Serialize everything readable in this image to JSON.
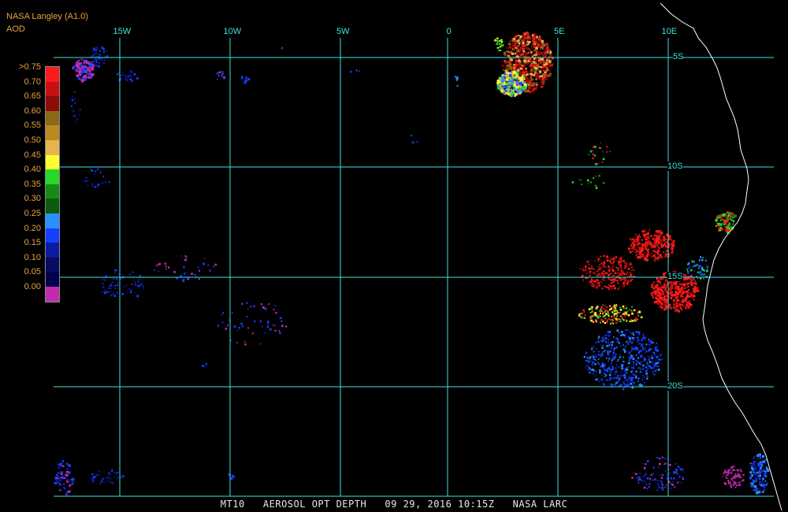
{
  "header": {
    "source": "NASA Langley (A1.0)",
    "variable": "AOD"
  },
  "legend": {
    "labels": [
      ">0.75",
      "0.70",
      "0.65",
      "0.60",
      "0.55",
      "0.50",
      "0.45",
      "0.40",
      "0.35",
      "0.30",
      "0.25",
      "0.20",
      "0.15",
      "0.10",
      "0.05",
      "0.00"
    ],
    "colors": [
      "#ff1a1a",
      "#c81010",
      "#8c0c0c",
      "#8a6a14",
      "#b88a20",
      "#e6b450",
      "#ffff30",
      "#28d828",
      "#168c16",
      "#0c5a0c",
      "#2890ff",
      "#1440ff",
      "#0c1ca0",
      "#0a0a60",
      "#000050",
      "#c02cb0"
    ]
  },
  "grid": {
    "lon_labels": [
      "15W",
      "10W",
      "5W",
      "0",
      "5E",
      "10E"
    ],
    "lat_labels": [
      "5S",
      "10S",
      "15S",
      "20S"
    ],
    "line_color": "#3ee0e0"
  },
  "footer": {
    "product": "MT10",
    "title": "AEROSOL OPT DEPTH",
    "date": "09 29, 2016",
    "time": "10:15Z",
    "agency": "NASA LARC"
  }
}
